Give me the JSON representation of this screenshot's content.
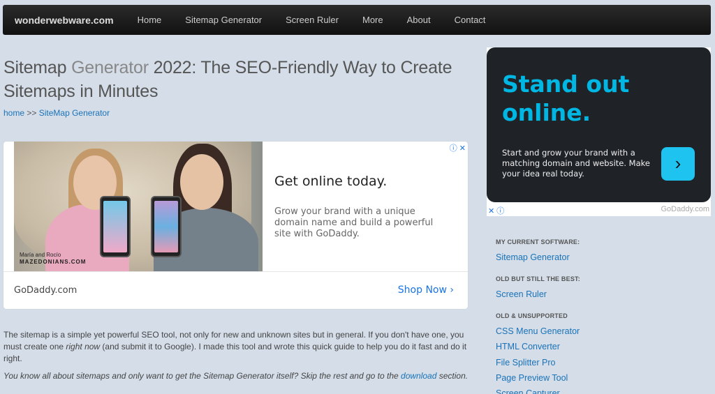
{
  "nav": {
    "brand": "wonderwebware.com",
    "items": [
      "Home",
      "Sitemap Generator",
      "Screen Ruler",
      "More",
      "About",
      "Contact"
    ]
  },
  "title": {
    "part1": "Sitemap ",
    "part2": "Generator",
    "part3": " 2022: The SEO-Friendly Way to Create Sitemaps in Minutes"
  },
  "breadcrumb": {
    "home": "home",
    "sep": " >> ",
    "current": "SiteMap Generator"
  },
  "ad_main": {
    "caption_line1": "María and Rocío",
    "caption_line2": "MAZEDONIANS.COM",
    "headline": "Get online today.",
    "body": "Grow your brand with a unique domain name and build a powerful site with GoDaddy.",
    "domain": "GoDaddy.com",
    "cta": "Shop Now",
    "cta_icon": "›",
    "choices_icon": "ⓘ ✕"
  },
  "paragraphs": {
    "intro_a": "The sitemap is a simple yet powerful SEO tool, not only for new and unknown sites but in general. If you don't have one, you must create one ",
    "intro_em": "right now",
    "intro_b": " (and submit it to Google). I made this tool and wrote this quick guide to help you do it fast and do it right.",
    "skip_a": "You know all about sitemaps and only want to get the Sitemap Generator itself? Skip the rest and go to the ",
    "skip_link": "download",
    "skip_b": " section."
  },
  "ad_side": {
    "headline": "Stand out online.",
    "body": "Start and grow your brand with a matching domain and website. Make your idea real today.",
    "button_icon": "›",
    "foot_icon": "✕ ⓘ",
    "domain": "GoDaddy.com"
  },
  "sidebar": {
    "current_heading": "MY CURRENT SOFTWARE:",
    "current": [
      "Sitemap Generator"
    ],
    "old_heading": "OLD BUT STILL THE BEST:",
    "old": [
      "Screen Ruler"
    ],
    "unsupported_heading": "OLD & UNSUPPORTED",
    "unsupported": [
      "CSS Menu Generator",
      "HTML Converter",
      "File Splitter Pro",
      "Page Preview Tool",
      "Screen Capturer"
    ]
  }
}
